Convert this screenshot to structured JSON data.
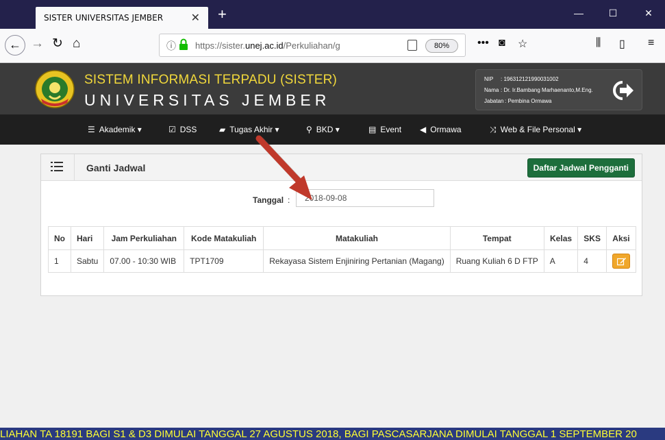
{
  "browser": {
    "tab_title": "SISTER UNIVERSITAS JEMBER",
    "tab_close": "✕",
    "new_tab": "+",
    "url_prefix": "https://sister.",
    "url_domain": "unej.ac.id",
    "url_path": "/Perkuliahan/g",
    "zoom": "80%",
    "page_actions": "•••"
  },
  "header": {
    "system_title": "SISTEM INFORMASI TERPADU (SISTER)",
    "university": "UNIVERSITAS JEMBER",
    "user": {
      "nip_label": "NIP",
      "nip_value": ": 196312121990031002",
      "nama_label": "Nama",
      "nama_value": ": Dr. Ir.Bambang Marhaenanto,M.Eng.",
      "jabatan_label": "Jabatan",
      "jabatan_value": ": Pembina Ormawa"
    }
  },
  "menu": [
    {
      "icon": "list-icon",
      "label": "Akademik ▾"
    },
    {
      "icon": "check-square-icon",
      "label": "DSS"
    },
    {
      "icon": "book-icon",
      "label": "Tugas Akhir ▾"
    },
    {
      "icon": "search-icon",
      "label": "BKD ▾"
    },
    {
      "icon": "calendar-icon",
      "label": "Event"
    },
    {
      "icon": "bullhorn-icon",
      "label": "Ormawa"
    },
    {
      "icon": "random-icon",
      "label": "Web & File Personal ▾"
    }
  ],
  "panel": {
    "title": "Ganti Jadwal",
    "button_label": "Daftar Jadwal Pengganti",
    "date_label": "Tanggal",
    "date_colon": ":",
    "date_value": "2018-09-08"
  },
  "table": {
    "headers": [
      "No",
      "Hari",
      "Jam Perkuliahan",
      "Kode Matakuliah",
      "Matakuliah",
      "Tempat",
      "Kelas",
      "SKS",
      "Aksi"
    ],
    "rows": [
      [
        "1",
        "Sabtu",
        "07.00 - 10:30 WIB",
        "TPT1709",
        "Rekayasa Sistem Enjiniring Pertanian (Magang)",
        "Ruang Kuliah 6 D FTP",
        "A",
        "4"
      ]
    ]
  },
  "ticker": "LIAHAN TA 18191 BAGI S1 & D3 DIMULAI TANGGAL 27 AGUSTUS 2018, BAGI PASCASARJANA DIMULAI TANGGAL 1 SEPTEMBER 20",
  "colors": {
    "header_bg": "#3b3b3b",
    "menubar_bg": "#1f1f1f",
    "system_title": "#f1d83b",
    "accent_green": "#1d6e3c",
    "edit_orange": "#f0a72b",
    "ticker_bg": "#2a3a80",
    "ticker_text": "#ffff33"
  }
}
